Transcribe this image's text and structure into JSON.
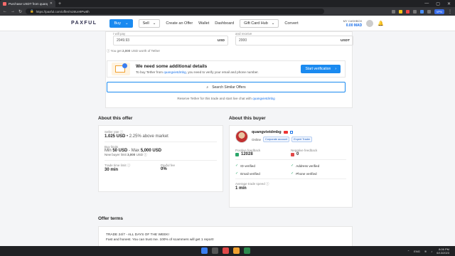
{
  "browser": {
    "tab_title": "Purchase USDT from quangvietdmbg...",
    "url": "https://paxful.com/offer/m26Ue9Pw8h",
    "vpn_label": "VPN"
  },
  "header": {
    "logo": "PAXFUL",
    "buy_label": "Buy",
    "sell_label": "Sell",
    "nav": [
      "Create an Offer",
      "Wallet",
      "Dashboard"
    ],
    "gift_label": "Gift Card Hub",
    "convert_label": "Convert",
    "balance_label": "MY CASHBOX",
    "balance_value": "0.00 MAD"
  },
  "trade": {
    "pay_label": "I will pay",
    "pay_value": "2049.93",
    "pay_unit": "USD",
    "receive_label": "and receive",
    "receive_value": "2000",
    "receive_unit": "USDT",
    "you_get_prefix": "You get",
    "you_get_amount": "2,000",
    "you_get_suffix": "USD worth of Tether"
  },
  "verify": {
    "title": "We need some additional details",
    "desc_prefix": "To buy Tether from",
    "desc_user": "quangvietdmbg",
    "desc_suffix": ", you need to verify your email and phone number.",
    "button": "Start verification"
  },
  "similar": {
    "label": "Search Similar Offers",
    "reserve_prefix": "Reserve Tether for this trade and start live chat with",
    "reserve_user": "quangvietdmbg"
  },
  "offer": {
    "section_title": "About this offer",
    "seller_rate_label": "Seller rate",
    "seller_rate_value": "1.025 USD",
    "seller_rate_extra": "• 2.25% above market",
    "buy_limits_label": "Buy limits",
    "min_label": "Min",
    "min_value": "50 USD",
    "max_label": "- Max",
    "max_value": "5,000 USD",
    "new_buyer_label": "New buyer limit",
    "new_buyer_value": "3,000",
    "new_buyer_unit": "USD",
    "trade_time_label": "Trade time limit",
    "trade_time_value": "30 min",
    "fee_label": "Paxful fee",
    "fee_value": "0%"
  },
  "buyer": {
    "section_title": "About this buyer",
    "name": "quangvietdmbg",
    "status": "Online",
    "badges": [
      "Corporate account",
      "Expert Trader"
    ],
    "positive_label": "Positive feedback",
    "positive_value": "12028",
    "negative_label": "Negative feedback",
    "negative_value": "0",
    "verifications": [
      "ID verified",
      "Address verified",
      "Email verified",
      "Phone verified"
    ],
    "avg_speed_label": "Average trade speed",
    "avg_speed_value": "1 min"
  },
  "terms": {
    "section_title": "Offer terms",
    "line1": "TRADE 24/7 - ALL DAYS OF THE WEEK!",
    "line2": "Fast and honest. You can trust me. 100% of scammers will get 1 report!"
  },
  "taskbar": {
    "lang": "ENG",
    "time": "8:06 PM",
    "date": "6/13/2023"
  }
}
